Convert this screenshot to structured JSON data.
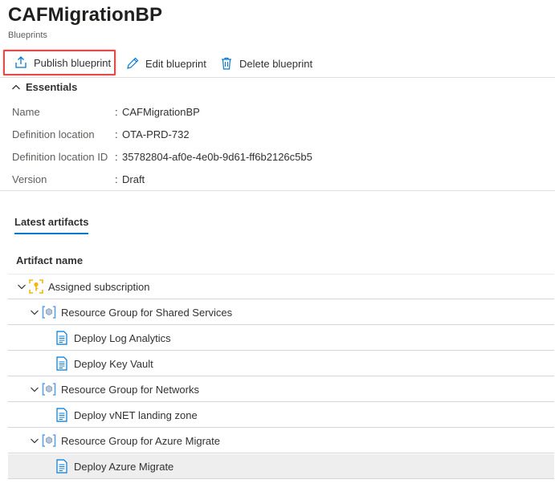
{
  "header": {
    "title": "CAFMigrationBP",
    "subtitle": "Blueprints"
  },
  "toolbar": {
    "publish_label": "Publish blueprint",
    "edit_label": "Edit blueprint",
    "delete_label": "Delete blueprint"
  },
  "essentials": {
    "heading": "Essentials",
    "properties": [
      {
        "label": "Name",
        "sep": ":",
        "value": "CAFMigrationBP"
      },
      {
        "label": "Definition location",
        "sep": ":",
        "value": "OTA-PRD-732"
      },
      {
        "label": "Definition location ID",
        "sep": ":",
        "value": "35782804-af0e-4e0b-9d61-ff6b2126c5b5"
      },
      {
        "label": "Version",
        "sep": ":",
        "value": "Draft"
      }
    ]
  },
  "artifacts": {
    "tab_label": "Latest artifacts",
    "column_header": "Artifact name",
    "rows": [
      {
        "label": "Assigned subscription",
        "kind": "subscription",
        "level": 0
      },
      {
        "label": "Resource Group for Shared Services",
        "kind": "resource-group",
        "level": 1
      },
      {
        "label": "Deploy Log Analytics",
        "kind": "template",
        "level": 2
      },
      {
        "label": "Deploy Key Vault",
        "kind": "template",
        "level": 2
      },
      {
        "label": "Resource Group for Networks",
        "kind": "resource-group",
        "level": 1
      },
      {
        "label": "Deploy vNET landing zone",
        "kind": "template",
        "level": 2
      },
      {
        "label": "Resource Group for Azure Migrate",
        "kind": "resource-group",
        "level": 1
      },
      {
        "label": "Deploy Azure Migrate",
        "kind": "template",
        "level": 2
      }
    ]
  },
  "colors": {
    "accent": "#0078d4",
    "highlight_border": "#e04b4b",
    "divider": "#e1dfdd"
  }
}
